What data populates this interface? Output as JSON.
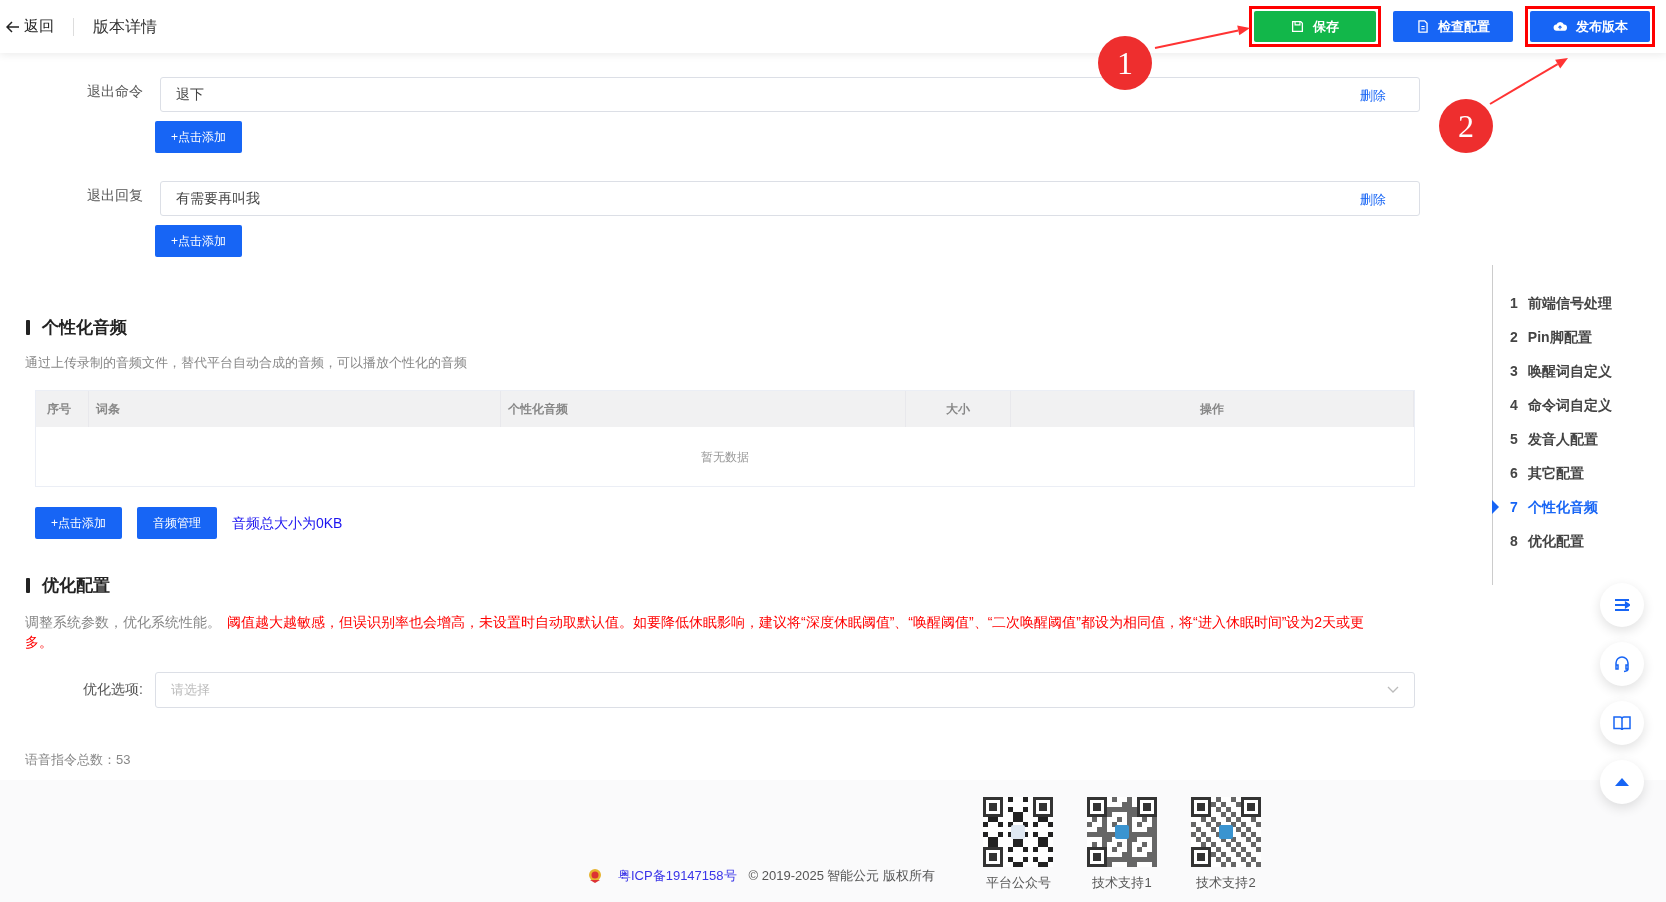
{
  "header": {
    "back": "返回",
    "title": "版本详情",
    "buttons": [
      {
        "label": "保存",
        "kind": "save",
        "highlighted": true,
        "annotation": "1"
      },
      {
        "label": "检查配置",
        "kind": "check",
        "highlighted": false
      },
      {
        "label": "发布版本",
        "kind": "publish",
        "highlighted": true,
        "annotation": "2"
      }
    ]
  },
  "exit_fields": [
    {
      "label": "退出命令",
      "value": "退下",
      "action": "删除",
      "add_button": "+点击添加"
    },
    {
      "label": "退出回复",
      "value": "有需要再叫我",
      "action": "删除",
      "add_button": "+点击添加"
    }
  ],
  "audio_section": {
    "title": "个性化音频",
    "description": "通过上传录制的音频文件，替代平台自动合成的音频，可以播放个性化的音频",
    "table": {
      "columns": [
        "序号",
        "词条",
        "个性化音频",
        "大小",
        "操作"
      ],
      "empty_text": "暂无数据"
    },
    "buttons": [
      "+点击添加",
      "音频管理"
    ],
    "total_size": "音频总大小为0KB"
  },
  "optimize_section": {
    "title": "优化配置",
    "description": "调整系统参数，优化系统性能。",
    "warning": "阈值越大越敏感，但误识别率也会增高，未设置时自动取默认值。如要降低休眠影响，建议将“深度休眠阈值”、“唤醒阈值”、“二次唤醒阈值”都设为相同值，将“进入休眠时间”设为2天或更多。",
    "select": {
      "label": "优化选项:",
      "placeholder": "请选择"
    }
  },
  "command_total": "语音指令总数：53",
  "nav": [
    {
      "number": "1",
      "label": "前端信号处理",
      "selected": false
    },
    {
      "number": "2",
      "label": "Pin脚配置",
      "selected": false
    },
    {
      "number": "3",
      "label": "唤醒词自定义",
      "selected": false
    },
    {
      "number": "4",
      "label": "命令词自定义",
      "selected": false
    },
    {
      "number": "5",
      "label": "发音人配置",
      "selected": false
    },
    {
      "number": "6",
      "label": "其它配置",
      "selected": false
    },
    {
      "number": "7",
      "label": "个性化音频",
      "selected": true
    },
    {
      "number": "8",
      "label": "优化配置",
      "selected": false
    }
  ],
  "float_buttons": [
    {
      "kind": "list"
    },
    {
      "kind": "support"
    },
    {
      "kind": "book"
    },
    {
      "kind": "top"
    }
  ],
  "footer": {
    "icp": "粤ICP备19147158号",
    "copyright": "© 2019-2025 智能公元 版权所有",
    "qr_codes": [
      {
        "label": "平台公众号"
      },
      {
        "label": "技术支持1"
      },
      {
        "label": "技术支持2"
      }
    ]
  }
}
